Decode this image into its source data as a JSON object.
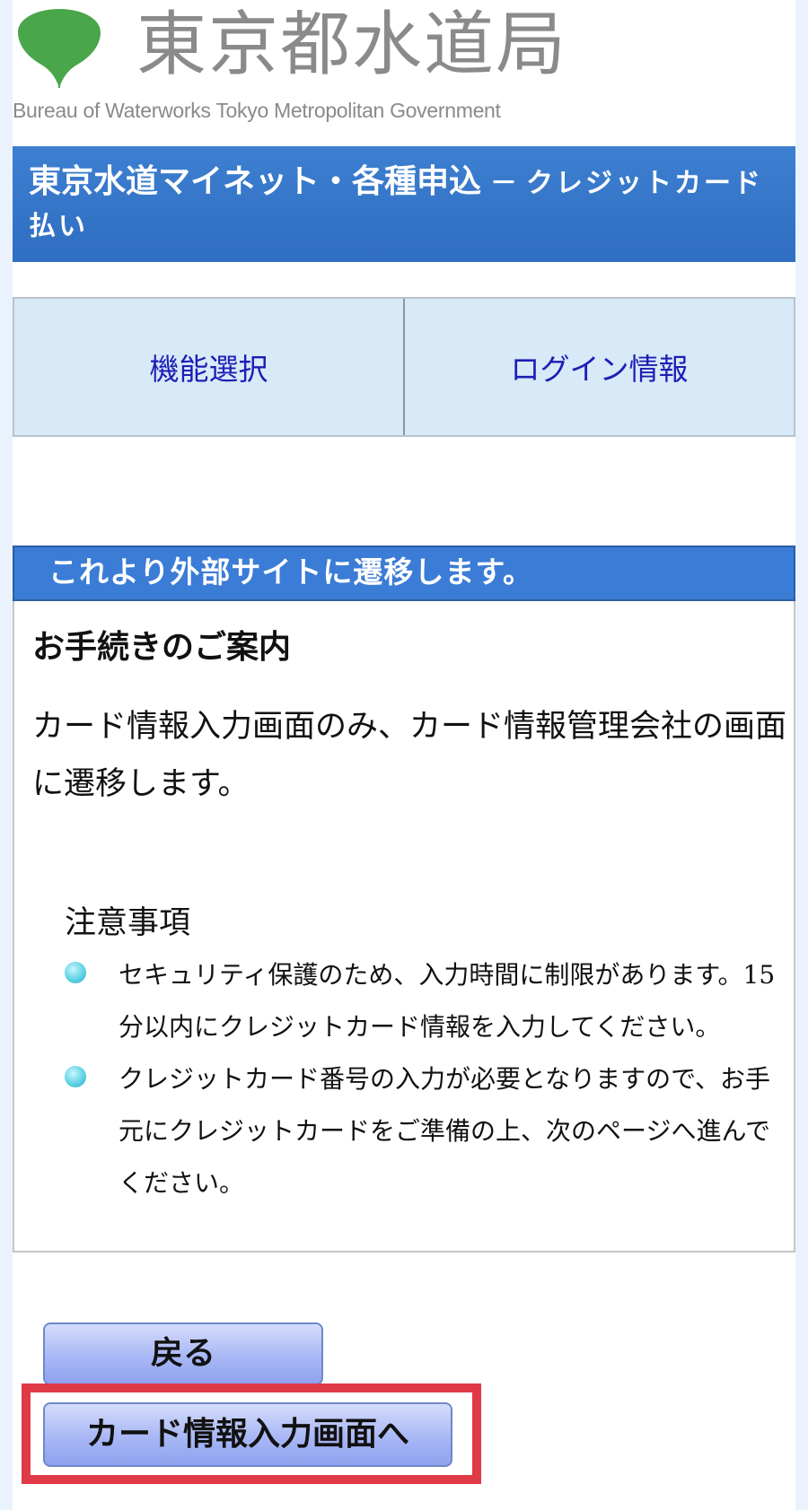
{
  "header": {
    "logo_title": "東京都水道局",
    "logo_subtitle": "Bureau of Waterworks Tokyo Metropolitan Government",
    "page_title": "東京水道マイネット・各種申込",
    "page_title_separator": "－",
    "page_subtitle": "クレジットカード払い"
  },
  "nav": {
    "tabs": [
      {
        "label": "機能選択"
      },
      {
        "label": "ログイン情報"
      }
    ]
  },
  "section": {
    "heading": "これより外部サイトに遷移します。"
  },
  "info": {
    "heading": "お手続きのご案内",
    "body": "カード情報入力画面のみ、カード情報管理会社の画面に遷移します。",
    "notes_title": "注意事項",
    "notes": [
      {
        "text": "セキュリティ保護のため、入力時間に制限があります。15分以内にクレジットカード情報を入力してください。"
      },
      {
        "text": "クレジットカード番号の入力が必要となりますので、お手元にクレジットカードをご準備の上、次のページへ進んでください。"
      }
    ]
  },
  "buttons": {
    "back_label": "戻る",
    "next_label": "カード情報入力画面へ"
  },
  "colors": {
    "title_bar": "#2f6ec2",
    "section_head": "#3b7cd6",
    "nav_bg": "#d8e9f8",
    "nav_text": "#1b1fb4",
    "highlight": "#e03a46",
    "page_bg": "#eaf3fd"
  }
}
